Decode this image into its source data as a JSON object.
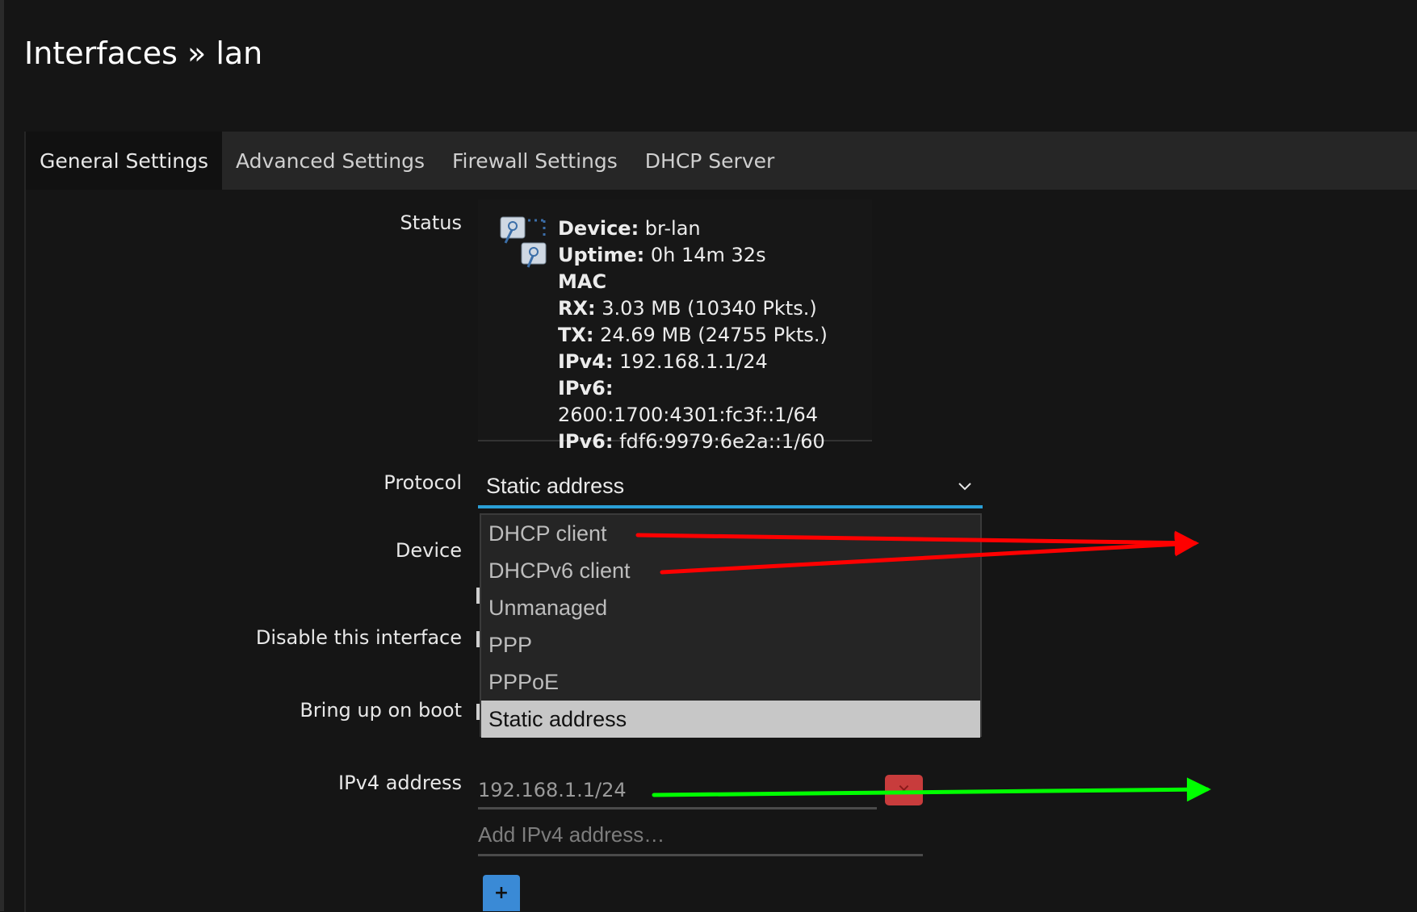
{
  "page": {
    "title": "Interfaces » lan"
  },
  "tabs": [
    {
      "label": "General Settings",
      "active": true
    },
    {
      "label": "Advanced Settings",
      "active": false
    },
    {
      "label": "Firewall Settings",
      "active": false
    },
    {
      "label": "DHCP Server",
      "active": false
    }
  ],
  "form": {
    "status_label": "Status",
    "protocol_label": "Protocol",
    "device_label": "Device",
    "disable_label": "Disable this interface",
    "boot_label": "Bring up on boot",
    "ipv4_label": "IPv4 address"
  },
  "status": {
    "device_key": "Device:",
    "device_val": " br-lan",
    "uptime_key": "Uptime:",
    "uptime_val": " 0h 14m 32s",
    "mac_key": "MAC",
    "rx_key": "RX:",
    "rx_val": " 3.03 MB (10340 Pkts.)",
    "tx_key": "TX:",
    "tx_val": " 24.69 MB (24755 Pkts.)",
    "ipv4_key": "IPv4:",
    "ipv4_val": " 192.168.1.1/24",
    "ipv6a_key": "IPv6:",
    "ipv6a_val": " 2600:1700:4301:fc3f::1/64",
    "ipv6b_key": "IPv6:",
    "ipv6b_val": " fdf6:9979:6e2a::1/60"
  },
  "protocol": {
    "selected": "Static address",
    "options": [
      "DHCP client",
      "DHCPv6 client",
      "Unmanaged",
      "PPP",
      "PPPoE",
      "Static address"
    ]
  },
  "ipv4": {
    "value": "192.168.1.1/24",
    "add_placeholder": "Add IPv4 address…",
    "add_button": "+"
  },
  "colors": {
    "accent": "#2a9fd6",
    "delete": "#c83c3c",
    "add": "#3a8ad6",
    "arrow_red": "#ff0000",
    "arrow_green": "#00ff00"
  }
}
